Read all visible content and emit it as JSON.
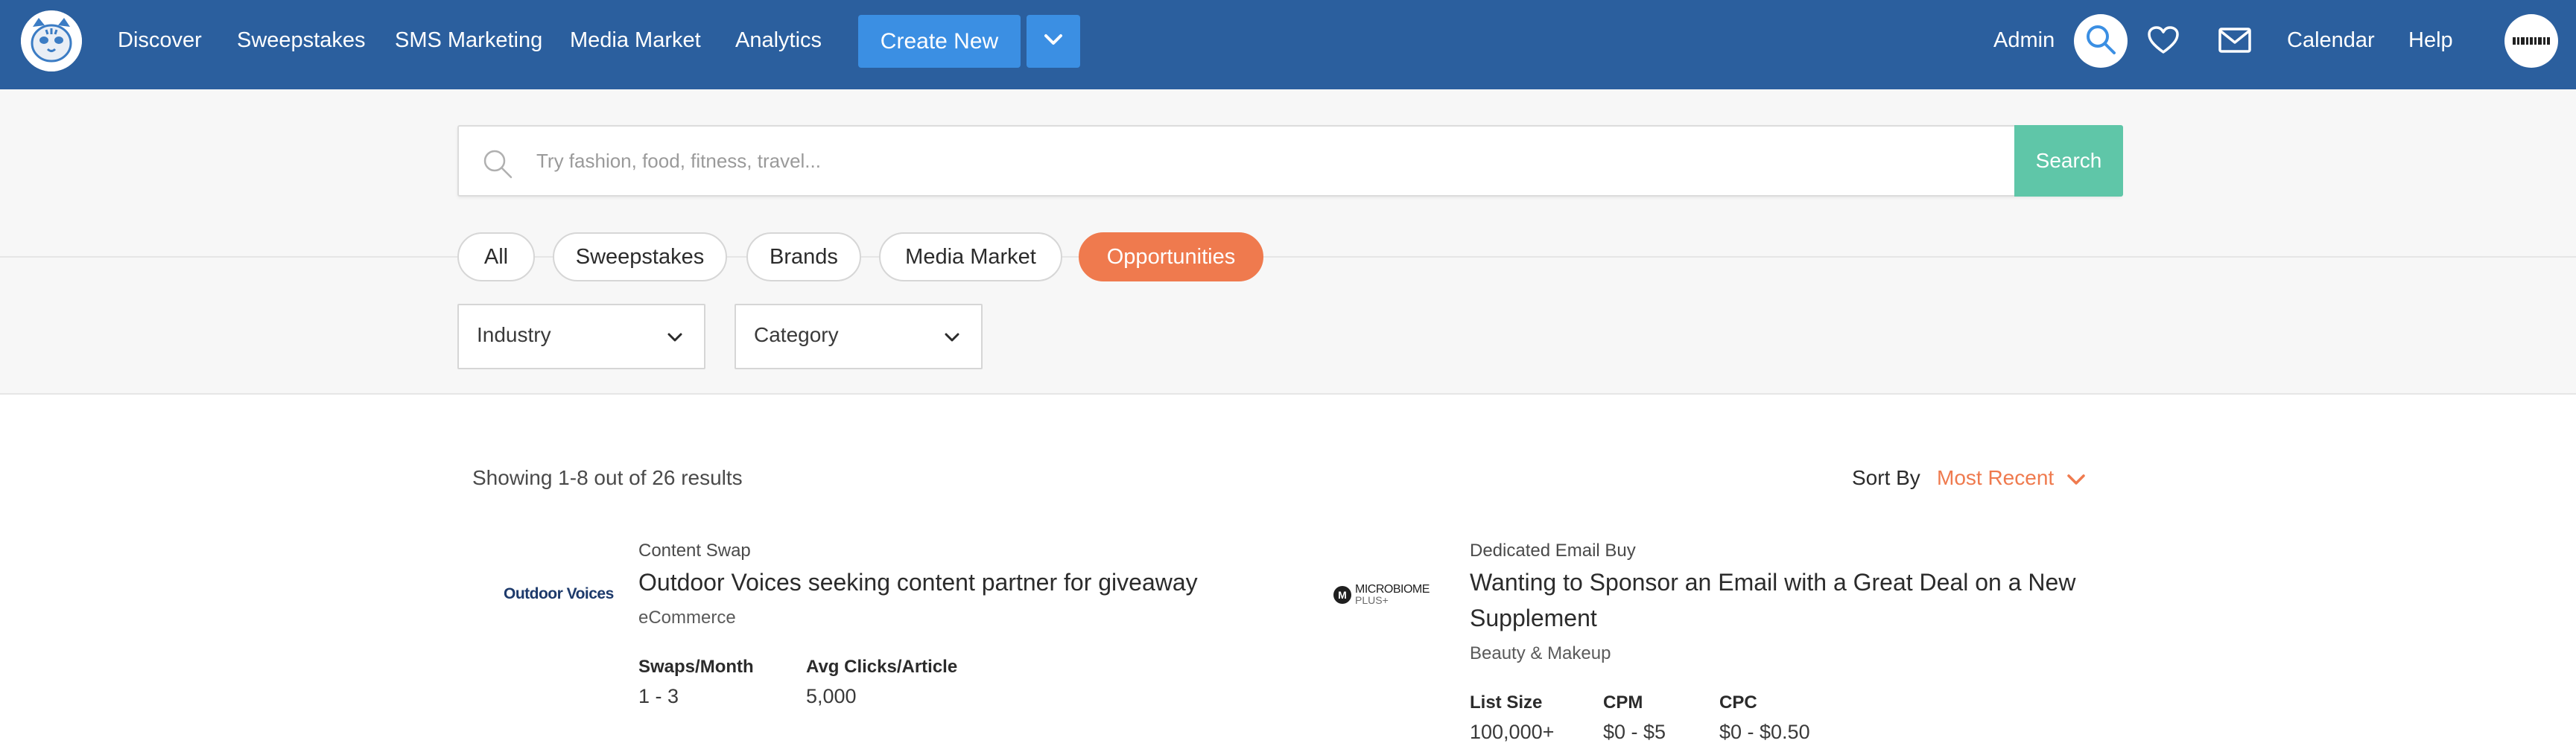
{
  "nav": {
    "links": [
      "Discover",
      "Sweepstakes",
      "SMS Marketing",
      "Media Market",
      "Analytics"
    ],
    "create_label": "Create New",
    "admin_label": "Admin",
    "calendar_label": "Calendar",
    "help_label": "Help",
    "brand_color": "#2b5f9e",
    "button_color": "#3b8fe3"
  },
  "search": {
    "placeholder": "Try fashion, food, fitness, travel...",
    "value": "",
    "button_label": "Search",
    "button_color": "#5fc6a8"
  },
  "filters": {
    "tabs": [
      "All",
      "Sweepstakes",
      "Brands",
      "Media Market",
      "Opportunities"
    ],
    "active_tab": "Opportunities",
    "accent_color": "#ef7a4e",
    "industry_label": "Industry",
    "category_label": "Category"
  },
  "results": {
    "count_text": "Showing 1-8 out of 26 results",
    "sort_label": "Sort By",
    "sort_value": "Most Recent"
  },
  "cards": [
    {
      "logo_text": "Outdoor Voices",
      "type": "Content Swap",
      "title": "Outdoor Voices seeking content partner for giveaway",
      "industry": "eCommerce",
      "stats": [
        {
          "label": "Swaps/Month",
          "value": "1 - 3"
        },
        {
          "label": "Avg Clicks/Article",
          "value": "5,000"
        }
      ]
    },
    {
      "logo_text_line1": "MICROBIOME",
      "logo_text_line2": "PLUS+",
      "logo_badge": "M",
      "type": "Dedicated Email Buy",
      "title_line1": "Wanting to Sponsor an Email with a Great Deal on a New",
      "title_line2": "Supplement",
      "industry": "Beauty & Makeup",
      "stats": [
        {
          "label": "List Size",
          "value": "100,000+"
        },
        {
          "label": "CPM",
          "value": "$0 - $5"
        },
        {
          "label": "CPC",
          "value": "$0 - $0.50"
        }
      ]
    }
  ],
  "icons": [
    "tiger-logo-icon",
    "chevron-down-icon",
    "search-icon",
    "heart-icon",
    "mail-icon",
    "search-icon",
    "chevron-down-icon"
  ]
}
